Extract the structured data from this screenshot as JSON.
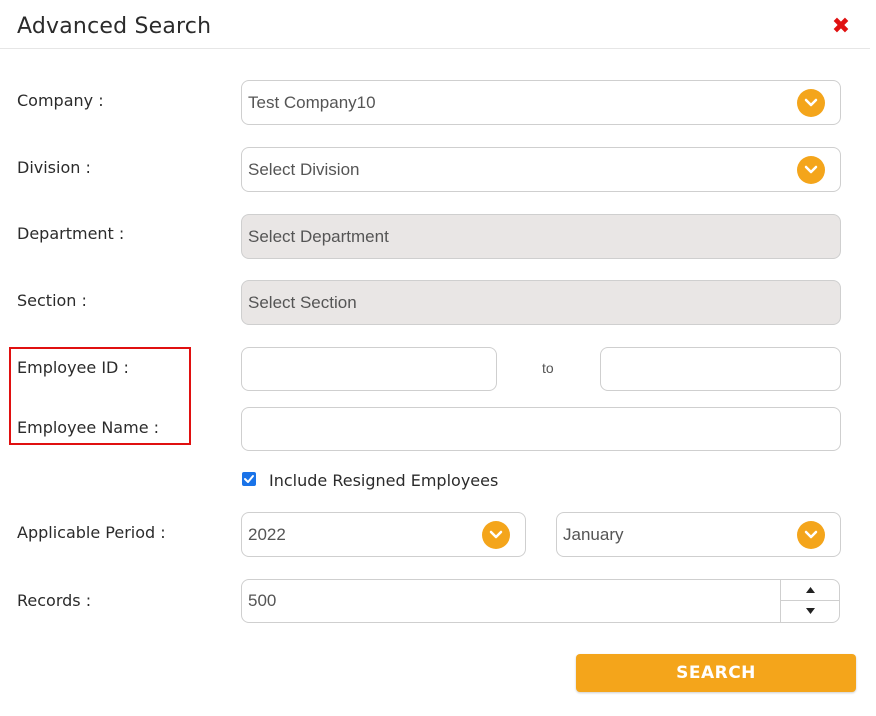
{
  "dialog": {
    "title": "Advanced Search",
    "close_icon": "close-icon"
  },
  "labels": {
    "company": "Company :",
    "division": "Division :",
    "department": "Department :",
    "section": "Section :",
    "employee_id": "Employee ID :",
    "employee_name": "Employee Name :",
    "applicable_period": "Applicable Period :",
    "records": "Records :"
  },
  "fields": {
    "company": {
      "value": "Test Company10"
    },
    "division": {
      "value": "Select Division"
    },
    "department": {
      "value": "Select Department"
    },
    "section": {
      "value": "Select Section"
    },
    "employee_id_from": {
      "value": ""
    },
    "employee_id_to": {
      "value": ""
    },
    "employee_id_separator": "to",
    "employee_name": {
      "value": ""
    },
    "include_resigned": {
      "label": "Include Resigned Employees",
      "checked": true
    },
    "period_year": {
      "value": "2022"
    },
    "period_month": {
      "value": "January"
    },
    "records": {
      "value": "500"
    }
  },
  "buttons": {
    "search": "SEARCH"
  },
  "colors": {
    "accent": "#f4a51b",
    "close": "#e01010",
    "highlight": "#e01010",
    "checkbox": "#1a73e8",
    "disabled_bg": "#e9e6e5"
  }
}
